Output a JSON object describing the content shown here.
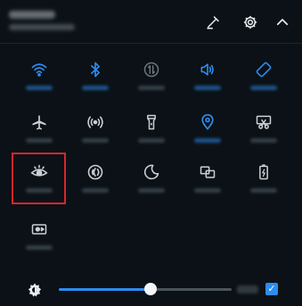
{
  "header": {
    "icons": [
      "edit-icon",
      "settings-gear-icon",
      "chevron-up-icon"
    ]
  },
  "tiles": [
    {
      "id": "wifi",
      "icon": "wifi-icon",
      "active": true
    },
    {
      "id": "bluetooth",
      "icon": "bluetooth-icon",
      "active": true
    },
    {
      "id": "mobile-data",
      "icon": "mobile-data-icon",
      "active": false
    },
    {
      "id": "sound",
      "icon": "sound-icon",
      "active": true
    },
    {
      "id": "auto-rotate",
      "icon": "auto-rotate-icon",
      "active": true
    },
    {
      "id": "airplane-mode",
      "icon": "airplane-icon",
      "active": false
    },
    {
      "id": "hotspot",
      "icon": "hotspot-icon",
      "active": false
    },
    {
      "id": "flashlight",
      "icon": "flashlight-icon",
      "active": false
    },
    {
      "id": "location",
      "icon": "location-pin-icon",
      "active": true
    },
    {
      "id": "screenshot",
      "icon": "screenshot-icon",
      "active": false
    },
    {
      "id": "eye-comfort",
      "icon": "eye-icon",
      "active": false
    },
    {
      "id": "nfc",
      "icon": "nfc-icon",
      "active": false
    },
    {
      "id": "do-not-disturb",
      "icon": "moon-icon",
      "active": false
    },
    {
      "id": "multi-screen",
      "icon": "multi-screen-icon",
      "active": false
    },
    {
      "id": "power-saving",
      "icon": "battery-icon",
      "active": false
    },
    {
      "id": "screen-recorder",
      "icon": "screen-recorder-icon",
      "active": false
    }
  ],
  "brightness": {
    "icon": "brightness-icon",
    "level": 0.53,
    "auto_checked": true
  },
  "colors": {
    "background": "#0b1116",
    "accent": "#2d8cf0",
    "icon_default": "#c9d1d6",
    "highlight_border": "#d7262b"
  }
}
